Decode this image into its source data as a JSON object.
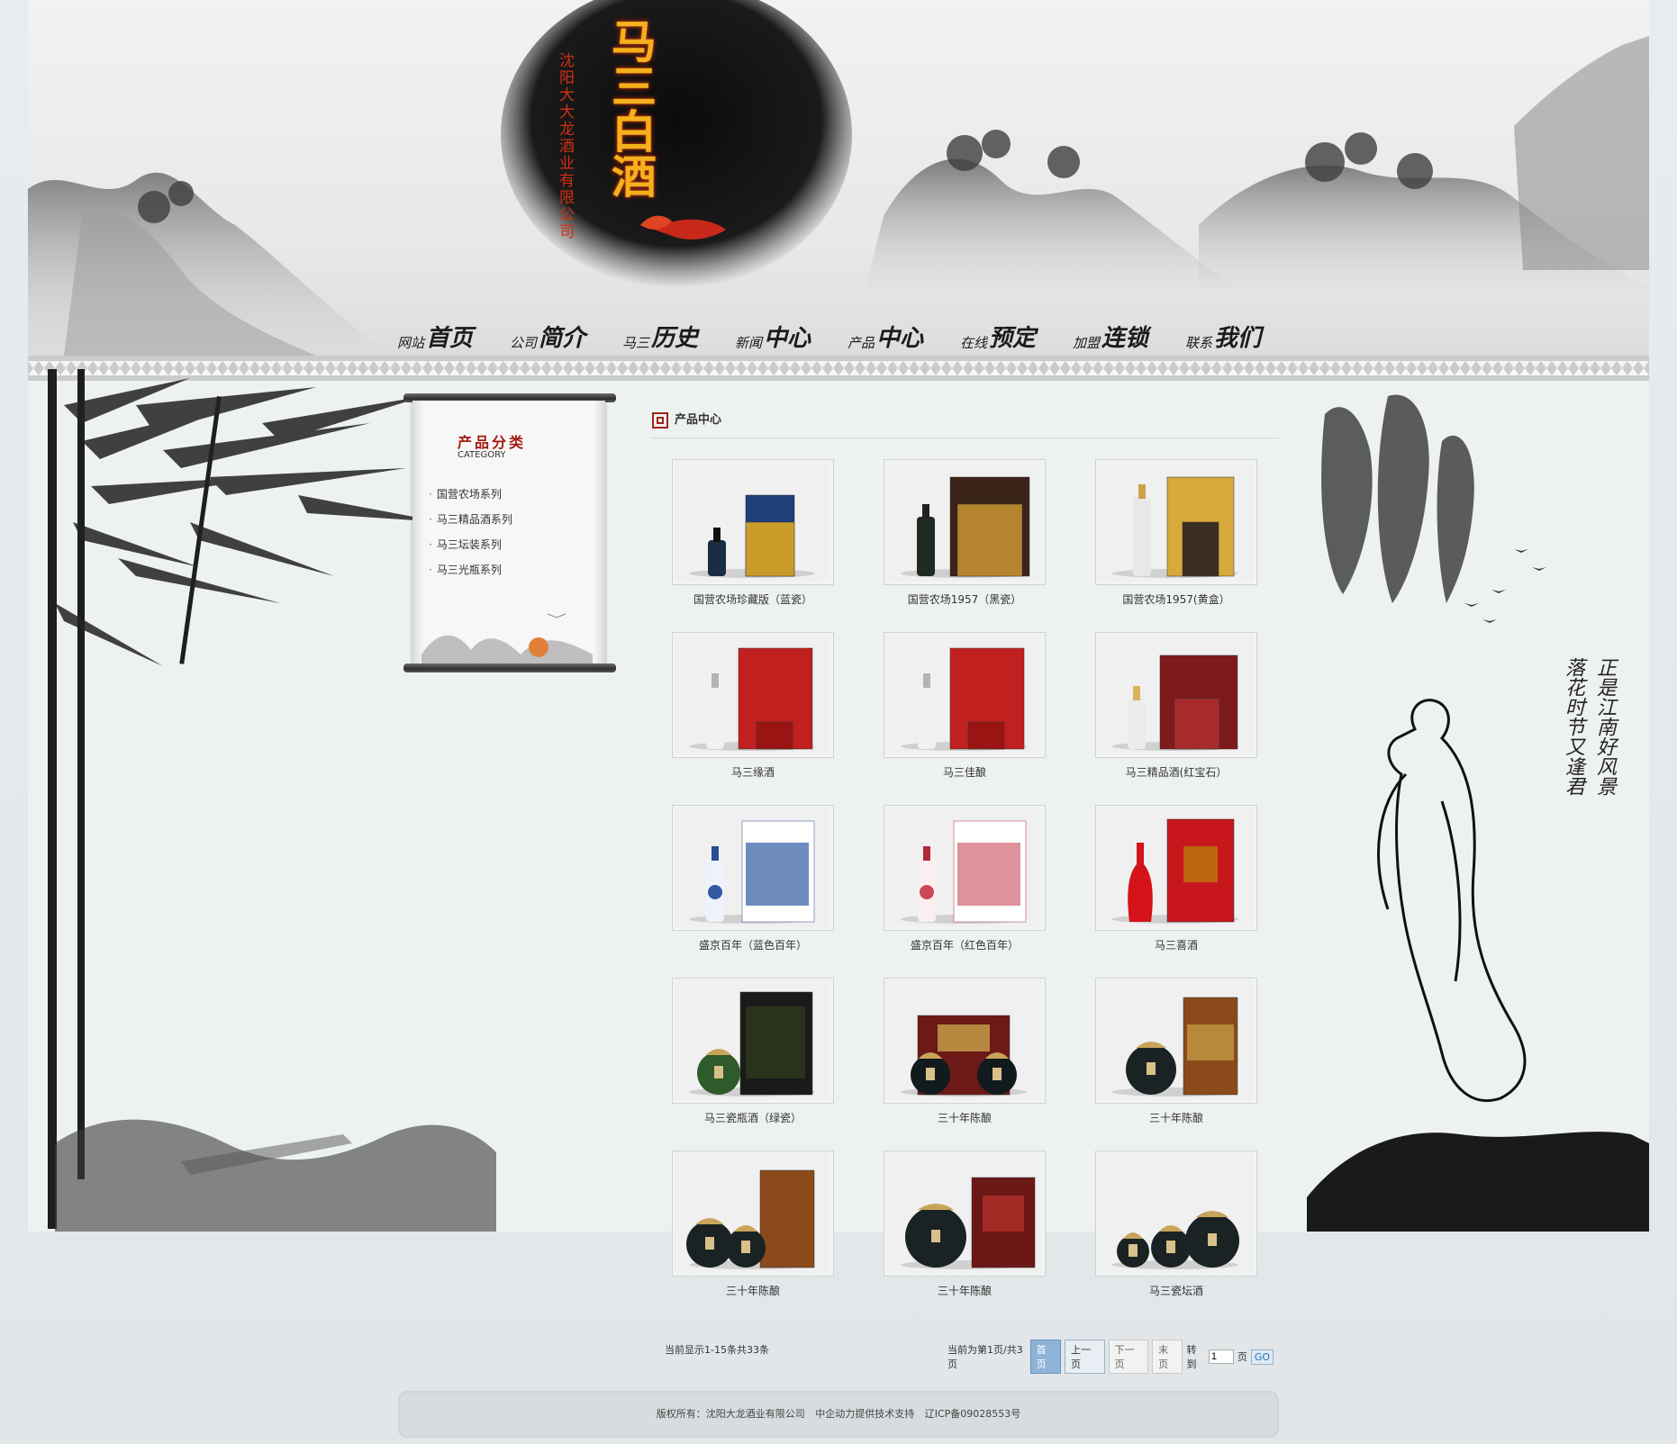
{
  "brand": {
    "title": "马三白酒",
    "company": "沈阳大大龙酒业有限公司"
  },
  "nav": [
    {
      "small": "网站",
      "big": "首页"
    },
    {
      "small": "公司",
      "big": "简介"
    },
    {
      "small": "马三",
      "big": "历史"
    },
    {
      "small": "新闻",
      "big": "中心"
    },
    {
      "small": "产品",
      "big": "中心"
    },
    {
      "small": "在线",
      "big": "预定"
    },
    {
      "small": "加盟",
      "big": "连锁"
    },
    {
      "small": "联系",
      "big": "我们"
    }
  ],
  "sidebar": {
    "title": "产品分类",
    "subtitle": "CATEGORY",
    "items": [
      "国营农场系列",
      "马三精品酒系列",
      "马三坛装系列",
      "马三光瓶系列"
    ]
  },
  "section": {
    "title": "产品中心"
  },
  "products": [
    {
      "title": "国营农场珍藏版（蓝瓷）",
      "style": "blue-box"
    },
    {
      "title": "国营农场1957（黑瓷）",
      "style": "black-bottle"
    },
    {
      "title": "国营农场1957(黄盒）",
      "style": "gold-box"
    },
    {
      "title": "马三缘酒",
      "style": "red-box"
    },
    {
      "title": "马三佳酿",
      "style": "red-box"
    },
    {
      "title": "马三精品酒(红宝石）",
      "style": "dark-red-box"
    },
    {
      "title": "盛京百年（蓝色百年）",
      "style": "blue-white"
    },
    {
      "title": "盛京百年（红色百年）",
      "style": "red-white"
    },
    {
      "title": "马三喜酒",
      "style": "red-vase"
    },
    {
      "title": "马三瓷瓶酒（绿瓷）",
      "style": "green-jar"
    },
    {
      "title": "三十年陈酿",
      "style": "jars-box"
    },
    {
      "title": "三十年陈酿",
      "style": "jar-tube"
    },
    {
      "title": "三十年陈酿",
      "style": "jars-tube"
    },
    {
      "title": "三十年陈酿",
      "style": "jar-redbox"
    },
    {
      "title": "马三瓷坛酒",
      "style": "three-jars"
    }
  ],
  "pagination": {
    "info": "当前显示1-15条共33条",
    "current": "当前为第1页/共3页",
    "first": "首页",
    "prev": "上一页",
    "next": "下一页",
    "last": "末页",
    "goto": "转到",
    "page_value": "1",
    "page_unit": "页",
    "go": "GO"
  },
  "footer": {
    "copyright": "版权所有：沈阳大龙酒业有限公司",
    "support": "中企动力提供技术支持",
    "icp": "辽ICP备09028553号"
  },
  "poem": {
    "line1": "正是江南好风景",
    "line2": "落花时节又逢君"
  },
  "colors": {
    "accent_red": "#a21a10",
    "brand_gold": "#f3b11c",
    "page_bg": "#e4e8ea"
  }
}
